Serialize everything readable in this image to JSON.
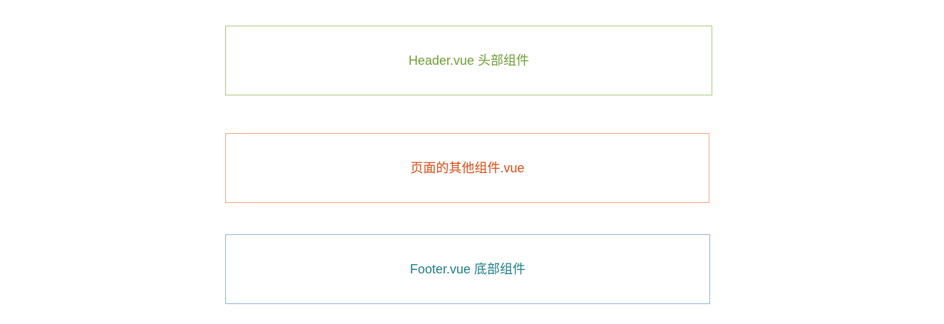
{
  "components": [
    {
      "id": "header",
      "label": "Header.vue 头部组件",
      "border_color": "#a4c882",
      "text_color": "#6d9e35"
    },
    {
      "id": "other",
      "label": "页面的其他组件.vue",
      "border_color": "#f0a387",
      "text_color": "#dd4a14"
    },
    {
      "id": "footer",
      "label": "Footer.vue 底部组件",
      "border_color": "#92b2dd",
      "text_color": "#1e7d87"
    }
  ]
}
